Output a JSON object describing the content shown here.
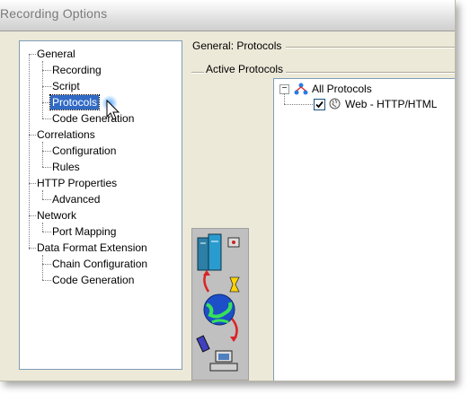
{
  "window": {
    "title": "Recording Options"
  },
  "tree": {
    "items": [
      {
        "label": "General"
      },
      {
        "label": "Recording"
      },
      {
        "label": "Script"
      },
      {
        "label": "Protocols"
      },
      {
        "label": "Code Generation"
      },
      {
        "label": "Correlations"
      },
      {
        "label": "Configuration"
      },
      {
        "label": "Rules"
      },
      {
        "label": "HTTP Properties"
      },
      {
        "label": "Advanced"
      },
      {
        "label": "Network"
      },
      {
        "label": "Port Mapping"
      },
      {
        "label": "Data Format Extension"
      },
      {
        "label": "Chain Configuration"
      },
      {
        "label": "Code Generation"
      }
    ],
    "selected": "Protocols"
  },
  "panel": {
    "title": "General: Protocols",
    "group_label": "Active Protocols"
  },
  "protocols": {
    "root_label": "All Protocols",
    "expander": "−",
    "items": [
      {
        "label": "Web - HTTP/HTML",
        "checked": true
      }
    ]
  },
  "colors": {
    "selection": "#316ac5",
    "window_bg": "#ece9d8",
    "border": "#7f9db9"
  },
  "icons": {
    "cursor": "arrow-cursor-icon",
    "root": "all-protocols-icon",
    "protocol": "web-globe-icon",
    "strip": "network-illustration"
  }
}
